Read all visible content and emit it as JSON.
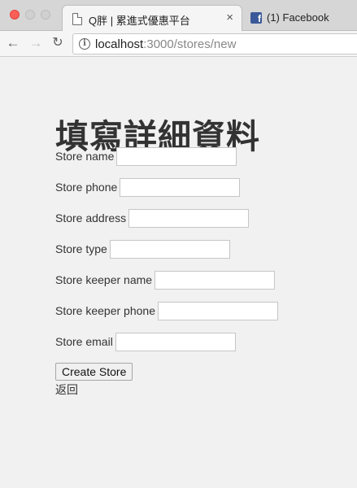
{
  "browser": {
    "active_tab": {
      "title": "Q胖 | 累進式優惠平台",
      "close": "×"
    },
    "inactive_tab": {
      "title": "(1) Facebook",
      "icon_letter": "f"
    },
    "toolbar": {
      "back": "←",
      "forward": "→",
      "reload": "↻",
      "url_host": "localhost",
      "url_path": ":3000/stores/new"
    }
  },
  "page": {
    "title": "填寫詳細資料",
    "fields": [
      {
        "label": "Store name",
        "value": ""
      },
      {
        "label": "Store phone",
        "value": ""
      },
      {
        "label": "Store address",
        "value": ""
      },
      {
        "label": "Store type",
        "value": ""
      },
      {
        "label": "Store keeper name",
        "value": ""
      },
      {
        "label": "Store keeper phone",
        "value": ""
      },
      {
        "label": "Store email",
        "value": ""
      }
    ],
    "submit_label": "Create Store",
    "back_link": "返回"
  },
  "colors": {
    "close_button": "#fc5f57",
    "facebook_brand": "#3b5998",
    "page_background": "#f1f1f1"
  }
}
